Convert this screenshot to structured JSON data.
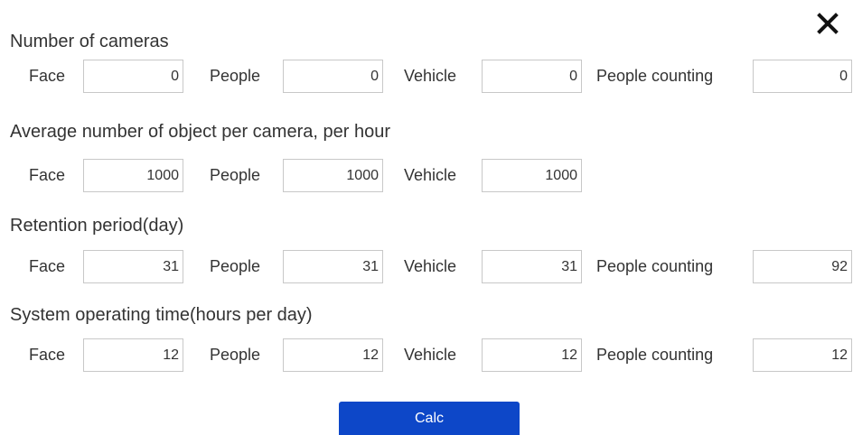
{
  "close": {
    "icon": "close-icon"
  },
  "sections": {
    "cameras": {
      "title": "Number of cameras",
      "face_label": "Face",
      "face_value": "0",
      "people_label": "People",
      "people_value": "0",
      "vehicle_label": "Vehicle",
      "vehicle_value": "0",
      "counting_label": "People counting",
      "counting_value": "0"
    },
    "objects": {
      "title": "Average number of object per camera, per hour",
      "face_label": "Face",
      "face_value": "1000",
      "people_label": "People",
      "people_value": "1000",
      "vehicle_label": "Vehicle",
      "vehicle_value": "1000"
    },
    "retention": {
      "title": "Retention period(day)",
      "face_label": "Face",
      "face_value": "31",
      "people_label": "People",
      "people_value": "31",
      "vehicle_label": "Vehicle",
      "vehicle_value": "31",
      "counting_label": "People counting",
      "counting_value": "92"
    },
    "operating": {
      "title": "System operating time(hours per day)",
      "face_label": "Face",
      "face_value": "12",
      "people_label": "People",
      "people_value": "12",
      "vehicle_label": "Vehicle",
      "vehicle_value": "12",
      "counting_label": "People counting",
      "counting_value": "12"
    }
  },
  "calc_button": {
    "label": "Calc"
  },
  "colors": {
    "accent": "#0d47c8",
    "text": "#333333",
    "border": "#c8c8c8"
  }
}
